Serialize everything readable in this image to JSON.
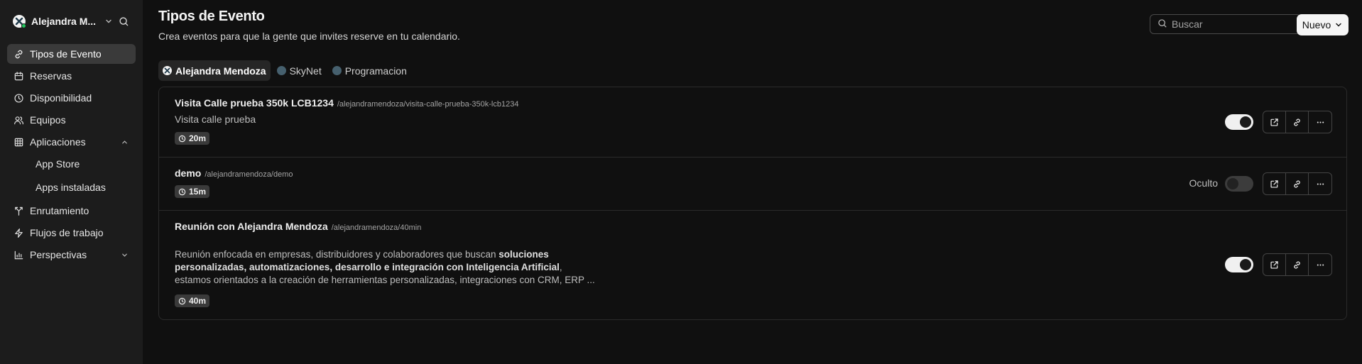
{
  "sidebar": {
    "user_name": "Alejandra M...",
    "items": [
      {
        "label": "Tipos de Evento",
        "icon": "link-icon"
      },
      {
        "label": "Reservas",
        "icon": "calendar-icon"
      },
      {
        "label": "Disponibilidad",
        "icon": "clock-icon"
      },
      {
        "label": "Equipos",
        "icon": "users-icon"
      },
      {
        "label": "Aplicaciones",
        "icon": "grid-icon"
      },
      {
        "label": "Enrutamiento",
        "icon": "split-icon"
      },
      {
        "label": "Flujos de trabajo",
        "icon": "zap-icon"
      },
      {
        "label": "Perspectivas",
        "icon": "bar-chart-icon"
      }
    ],
    "subitems": [
      {
        "label": "App Store"
      },
      {
        "label": "Apps instaladas"
      }
    ]
  },
  "header": {
    "title": "Tipos de Evento",
    "subtitle": "Crea eventos para que la gente que invites reserve en tu calendario.",
    "search_placeholder": "Buscar",
    "new_label": "Nuevo"
  },
  "filters": [
    {
      "label": "Alejandra Mendoza"
    },
    {
      "label": "SkyNet"
    },
    {
      "label": "Programacion"
    }
  ],
  "events": [
    {
      "title": "Visita Calle prueba 350k LCB1234",
      "slug": "/alejandramendoza/visita-calle-prueba-350k-lcb1234",
      "description": "Visita calle prueba",
      "duration": "20m",
      "enabled": true
    },
    {
      "title": "demo",
      "slug": "/alejandramendoza/demo",
      "hidden_label": "Oculto",
      "duration": "15m",
      "enabled": false
    },
    {
      "title": "Reunión con Alejandra Mendoza",
      "slug": "/alejandramendoza/40min",
      "desc_part1": "Reunión enfocada en empresas, distribuidores y colaboradores que buscan ",
      "desc_bold": "soluciones personalizadas, automatizaciones, desarrollo e integración con Inteligencia Artificial",
      "desc_part2": ", estamos orientados a la creación de herramientas personalizadas, integraciones con CRM, ERP ...",
      "duration": "40m",
      "enabled": true
    }
  ],
  "colors": {
    "background": "#101010",
    "sidebar": "#1c1c1c",
    "active_item": "#3a3a3a",
    "online": "#22c55e"
  }
}
